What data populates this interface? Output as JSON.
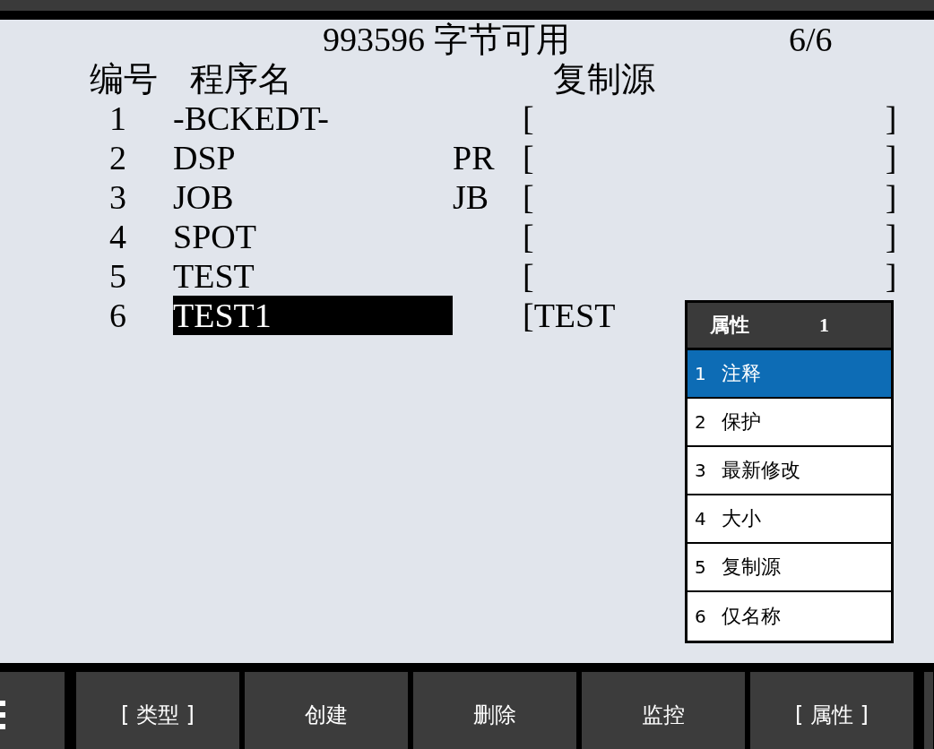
{
  "header": {
    "free_bytes": "993596 字节可用",
    "count": "6/6"
  },
  "columns": [
    "编号",
    "程序名",
    "复制源"
  ],
  "programs": [
    {
      "number": "1",
      "name": "-BCKEDT-",
      "open_bracket": "[",
      "close_bracket": "]",
      "selected": false
    },
    {
      "number": "2",
      "name": "DSP",
      "type": "PR",
      "open_bracket": "[",
      "close_bracket": "]",
      "selected": false
    },
    {
      "number": "3",
      "name": "JOB",
      "type": "JB",
      "open_bracket": "[",
      "close_bracket": "]",
      "selected": false
    },
    {
      "number": "4",
      "name": "SPOT",
      "open_bracket": "[",
      "close_bracket": "]",
      "selected": false
    },
    {
      "number": "5",
      "name": "TEST",
      "open_bracket": "[",
      "close_bracket": "]",
      "selected": false
    },
    {
      "number": "6",
      "name": "TEST1",
      "open_bracket": "[",
      "copy_source": "TEST",
      "selected": true
    }
  ],
  "popup": {
    "title": "属性",
    "page": "1",
    "items": [
      {
        "number": "1",
        "label": "注释",
        "selected": true
      },
      {
        "number": "2",
        "label": "保护",
        "selected": false
      },
      {
        "number": "3",
        "label": "最新修改",
        "selected": false
      },
      {
        "number": "4",
        "label": "大小",
        "selected": false
      },
      {
        "number": "5",
        "label": "复制源",
        "selected": false
      },
      {
        "number": "6",
        "label": "仅名称",
        "selected": false
      }
    ]
  },
  "softkeys": [
    "[ 类型 ]",
    "创建",
    "删除",
    "监控",
    "[ 属性 ]"
  ]
}
